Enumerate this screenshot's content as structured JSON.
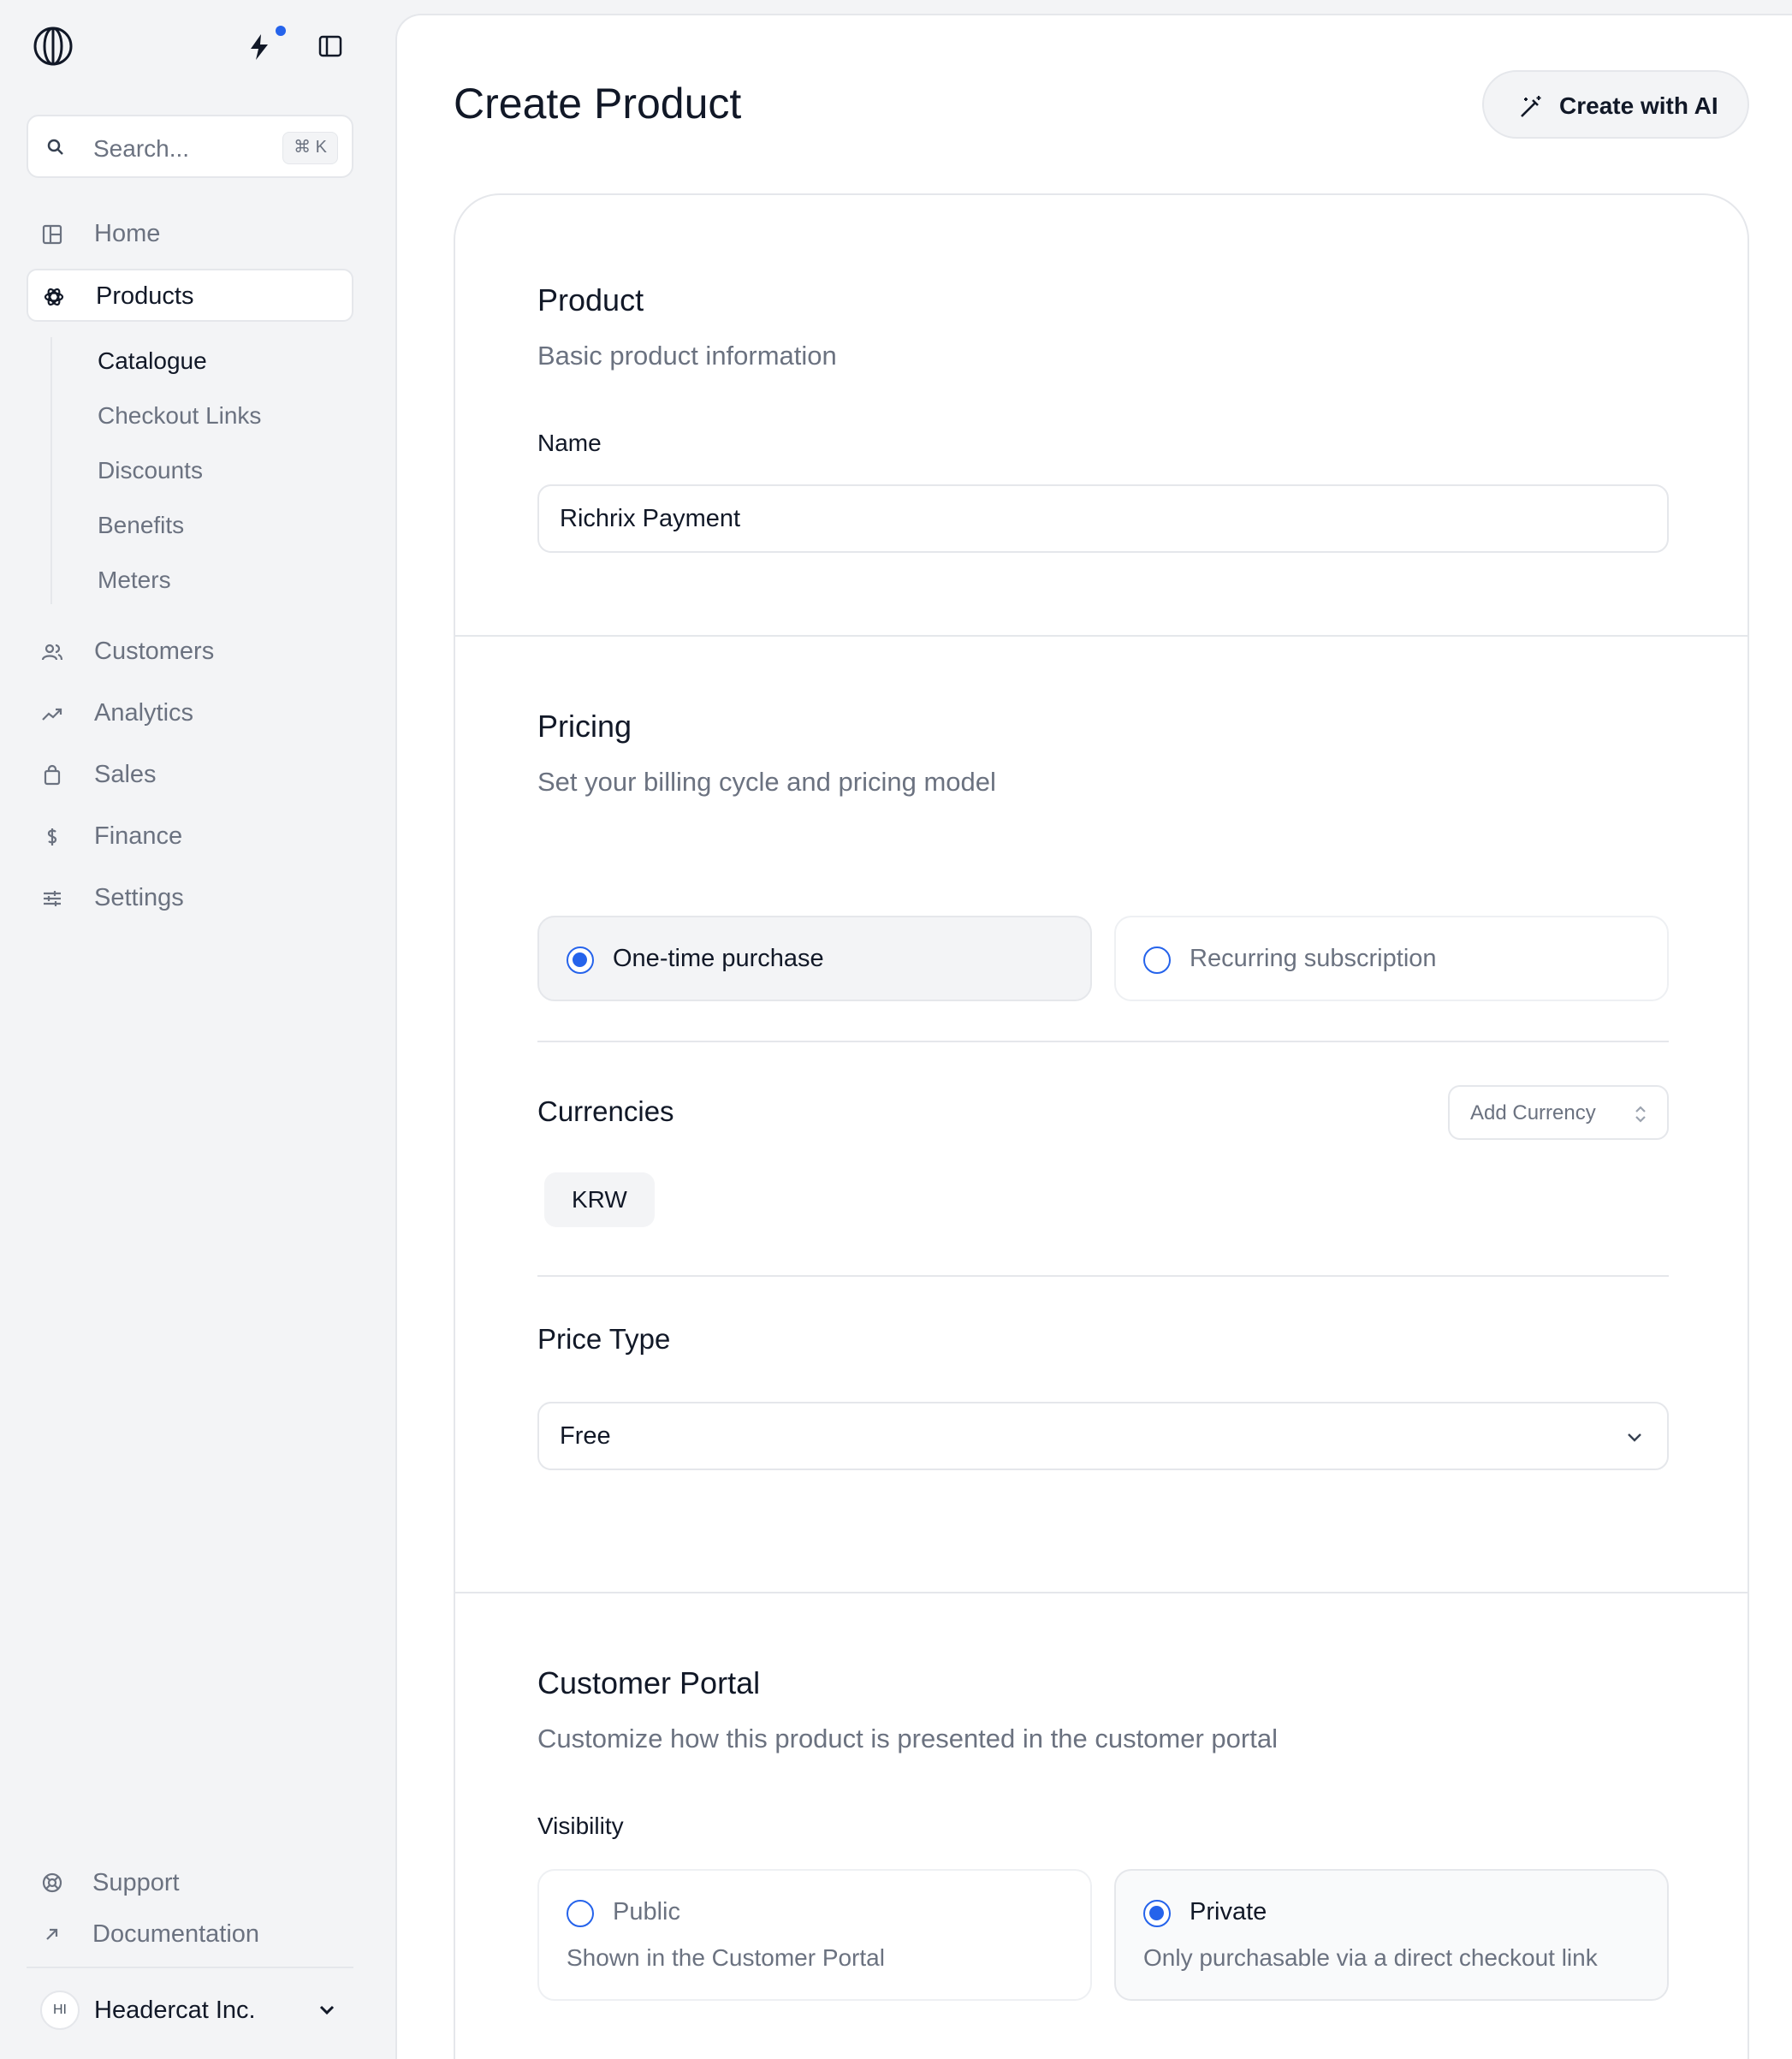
{
  "sidebar": {
    "search": {
      "placeholder": "Search...",
      "shortcut": "⌘ K"
    },
    "nav": [
      {
        "label": "Home",
        "icon": "grid-icon"
      },
      {
        "label": "Products",
        "icon": "products-icon",
        "active": true
      },
      {
        "label": "Customers",
        "icon": "users-icon"
      },
      {
        "label": "Analytics",
        "icon": "trend-icon"
      },
      {
        "label": "Sales",
        "icon": "bag-icon"
      },
      {
        "label": "Finance",
        "icon": "dollar-icon"
      },
      {
        "label": "Settings",
        "icon": "sliders-icon"
      }
    ],
    "products_sub": [
      {
        "label": "Catalogue",
        "active": true
      },
      {
        "label": "Checkout Links"
      },
      {
        "label": "Discounts"
      },
      {
        "label": "Benefits"
      },
      {
        "label": "Meters"
      }
    ],
    "footer": {
      "support": "Support",
      "documentation": "Documentation",
      "org_initials": "HI",
      "org_name": "Headercat Inc."
    }
  },
  "main": {
    "title": "Create Product",
    "ai_button": "Create with AI",
    "product": {
      "title": "Product",
      "subtitle": "Basic product information",
      "name_label": "Name",
      "name_value": "Richrix Payment"
    },
    "pricing": {
      "title": "Pricing",
      "subtitle": "Set your billing cycle and pricing model",
      "options": [
        {
          "label": "One-time purchase",
          "selected": true
        },
        {
          "label": "Recurring subscription",
          "selected": false
        }
      ],
      "currencies_label": "Currencies",
      "add_currency": "Add Currency",
      "currency_chip": "KRW",
      "price_type_label": "Price Type",
      "price_type_value": "Free"
    },
    "portal": {
      "title": "Customer Portal",
      "subtitle": "Customize how this product is presented in the customer portal",
      "visibility_label": "Visibility",
      "options": [
        {
          "label": "Public",
          "desc": "Shown in the Customer Portal",
          "selected": false
        },
        {
          "label": "Private",
          "desc": "Only purchasable via a direct checkout link",
          "selected": true
        }
      ]
    }
  },
  "colors": {
    "accent": "#2563eb",
    "muted_text": "#6b7280",
    "border": "#e5e7eb"
  }
}
